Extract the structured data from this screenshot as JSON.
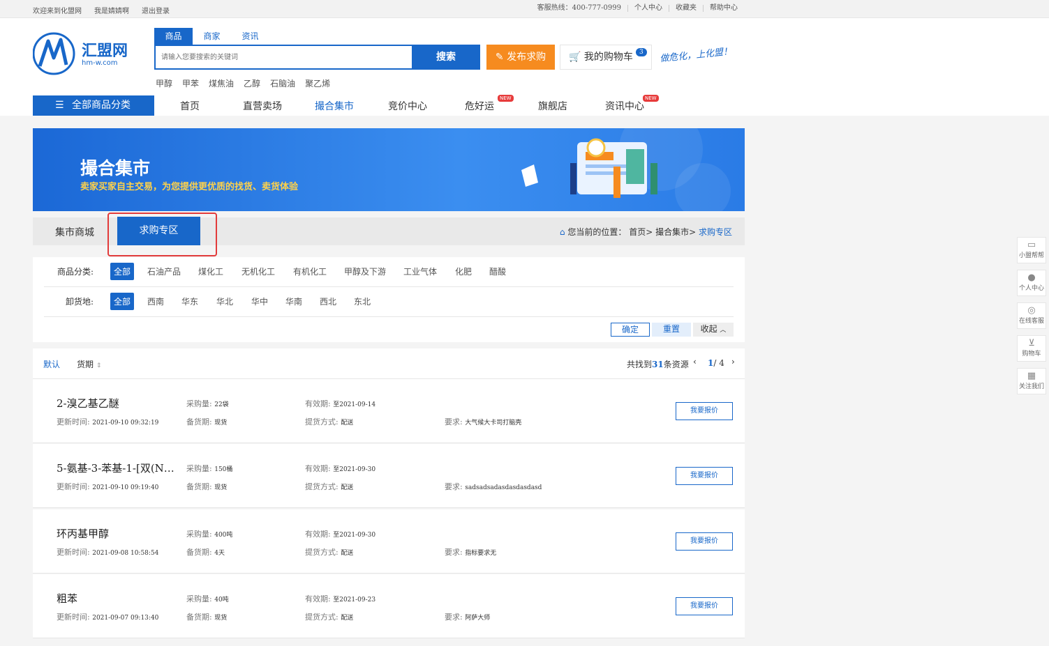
{
  "topbar": {
    "welcome": "欢迎来到化盟网",
    "user": "我是婧婧啊",
    "logout": "退出登录",
    "hotline": "客服热线：400-777-0999",
    "personal": "个人中心",
    "favorites": "收藏夹",
    "help": "帮助中心"
  },
  "logo": {
    "name": "汇盟网",
    "domain": "hm-w.com"
  },
  "search": {
    "tabs": [
      "商品",
      "商家",
      "资讯"
    ],
    "placeholder": "请输入您要搜索的关键词",
    "button": "搜索",
    "hot": [
      "甲醇",
      "甲苯",
      "煤焦油",
      "乙醇",
      "石脑油",
      "聚乙烯"
    ]
  },
  "publish": "发布求购",
  "cart": {
    "label": "我的购物车",
    "count": "3"
  },
  "slogan": "做危化，上化盟！",
  "nav": {
    "all": "全部商品分类",
    "items": [
      "首页",
      "直营卖场",
      "撮合集市",
      "竞价中心",
      "危好运",
      "旗舰店",
      "资讯中心"
    ],
    "new": "NEW"
  },
  "banner": {
    "title": "撮合集市",
    "subtitle": "卖家买家自主交易，为您提供更优质的找货、卖货体验"
  },
  "subnav": {
    "tab1": "集市商城",
    "tab2": "求购专区",
    "crumb_label": "您当前的位置：",
    "crumb_path": "首页> 撮合集市>",
    "crumb_current": "求购专区"
  },
  "filter": {
    "cat_label": "商品分类:",
    "cats": [
      "全部",
      "石油产品",
      "煤化工",
      "无机化工",
      "有机化工",
      "甲醇及下游",
      "工业气体",
      "化肥",
      "醋酸"
    ],
    "region_label": "卸货地:",
    "regions": [
      "全部",
      "西南",
      "华东",
      "华北",
      "华中",
      "华南",
      "西北",
      "东北"
    ],
    "confirm": "确定",
    "reset": "重置",
    "collapse": "收起"
  },
  "list": {
    "sort_default": "默认",
    "sort_period": "货期",
    "found_pre": "共找到",
    "found_count": "31",
    "found_post": "条资源",
    "page": "1",
    "pages": "/ 4"
  },
  "labels": {
    "qty": "采购量:",
    "valid": "有效期:",
    "updated": "更新时间:",
    "stock": "备货期:",
    "pickup": "提货方式:",
    "require": "要求:",
    "quote": "我要报价"
  },
  "items": [
    {
      "name": "2-溴乙基乙醚",
      "qty": "22袋",
      "valid": "至2021-09-14",
      "updated": "2021-09-10 09:32:19",
      "stock": "现货",
      "pickup": "配送",
      "require": "大气候大卡司打脑壳"
    },
    {
      "name": "5-氨基-3-苯基-1-[双(N…",
      "qty": "150桶",
      "valid": "至2021-09-30",
      "updated": "2021-09-10 09:19:40",
      "stock": "现货",
      "pickup": "配送",
      "require": "sadsadsadasdasdasdasd"
    },
    {
      "name": "环丙基甲醇",
      "qty": "400吨",
      "valid": "至2021-09-30",
      "updated": "2021-09-08 10:58:54",
      "stock": "4天",
      "pickup": "配送",
      "require": "指标要求无"
    },
    {
      "name": "粗苯",
      "qty": "40吨",
      "valid": "至2021-09-23",
      "updated": "2021-09-07 09:13:40",
      "stock": "现货",
      "pickup": "配送",
      "require": "阿萨大师"
    }
  ],
  "sidebar": [
    "小盟帮帮",
    "个人中心",
    "在线客服",
    "购物车",
    "关注我们"
  ],
  "colors": {
    "brand": "#1867c9",
    "orange": "#f68b1f",
    "highlight": "#e23a3a"
  }
}
